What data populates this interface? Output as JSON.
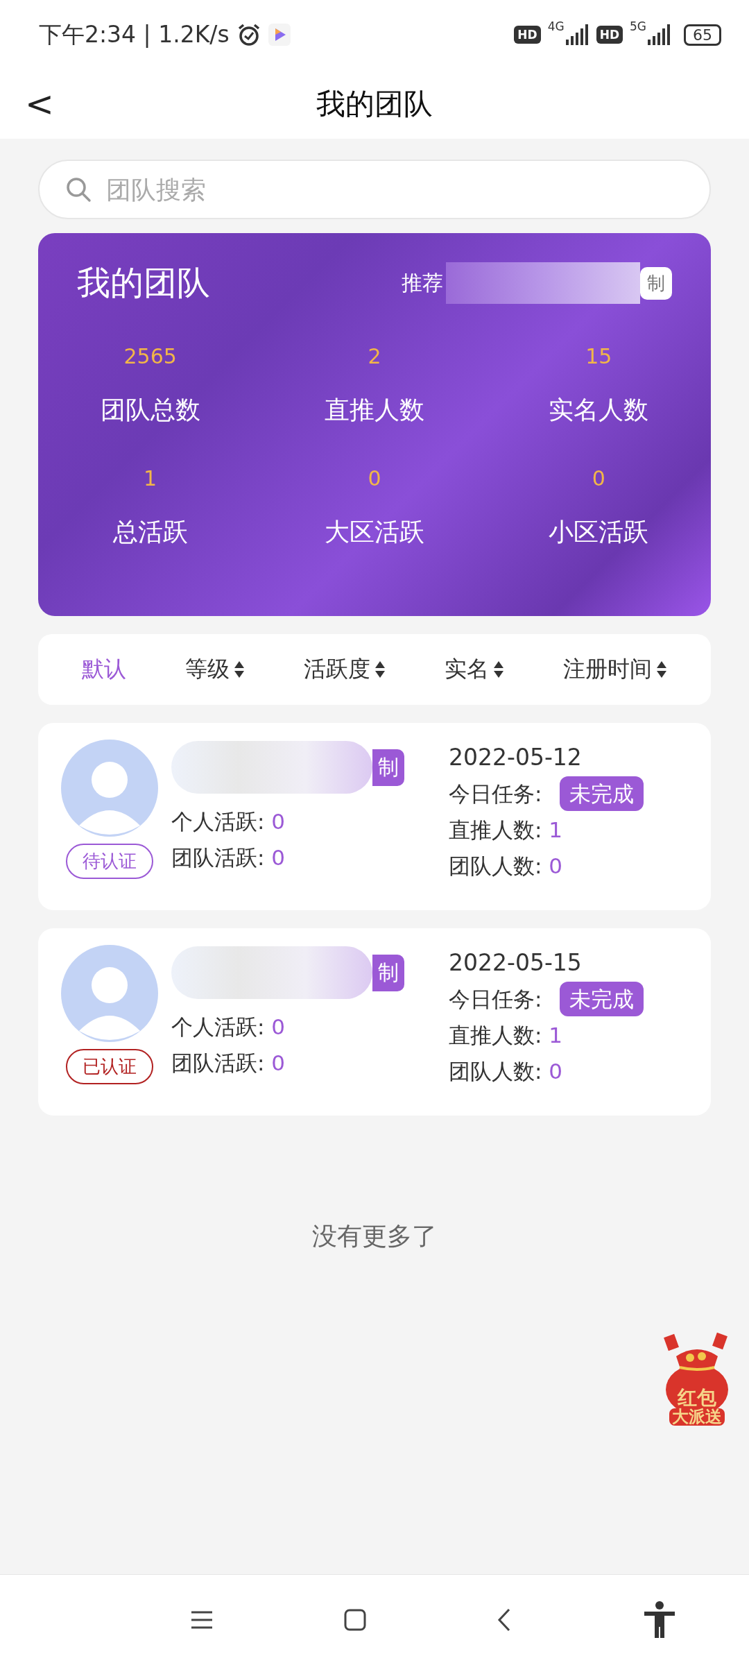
{
  "status_bar": {
    "time": "下午2:34 | 1.2K/s",
    "battery": "65",
    "net_1": "4G",
    "net_2": "5G",
    "hd_1": "HD",
    "hd_2": "HD"
  },
  "header": {
    "back": "<",
    "title": "我的团队"
  },
  "search": {
    "placeholder": "团队搜索"
  },
  "summary": {
    "title": "我的团队",
    "referrer_label": "推荐",
    "copy_button": "制",
    "stats": [
      {
        "value": "2565",
        "label": "团队总数"
      },
      {
        "value": "2",
        "label": "直推人数"
      },
      {
        "value": "15",
        "label": "实名人数"
      },
      {
        "value": "1",
        "label": "总活跃"
      },
      {
        "value": "0",
        "label": "大区活跃"
      },
      {
        "value": "0",
        "label": "小区活跃"
      }
    ]
  },
  "sort_tabs": [
    {
      "label": "默认",
      "selected": true,
      "sortable": false
    },
    {
      "label": "等级",
      "selected": false,
      "sortable": true
    },
    {
      "label": "活跃度",
      "selected": false,
      "sortable": true
    },
    {
      "label": "实名",
      "selected": false,
      "sortable": true
    },
    {
      "label": "注册时间",
      "selected": false,
      "sortable": true
    }
  ],
  "members": [
    {
      "copy_tag": "制",
      "verification": {
        "kind": "pending",
        "label": "待认证"
      },
      "personal_active_label": "个人活跃:",
      "personal_active": "0",
      "team_active_label": "团队活跃:",
      "team_active": "0",
      "date": "2022-05-12",
      "task_label": "今日任务:",
      "task_status": "未完成",
      "direct_label": "直推人数:",
      "direct": "1",
      "team_size_label": "团队人数:",
      "team_size": "0"
    },
    {
      "copy_tag": "制",
      "verification": {
        "kind": "verified",
        "label": "已认证"
      },
      "personal_active_label": "个人活跃:",
      "personal_active": "0",
      "team_active_label": "团队活跃:",
      "team_active": "0",
      "date": "2022-05-15",
      "task_label": "今日任务:",
      "task_status": "未完成",
      "direct_label": "直推人数:",
      "direct": "1",
      "team_size_label": "团队人数:",
      "team_size": "0"
    }
  ],
  "end_message": "没有更多了",
  "red_packet": {
    "line_1": "红包",
    "line_2": "大派送"
  }
}
